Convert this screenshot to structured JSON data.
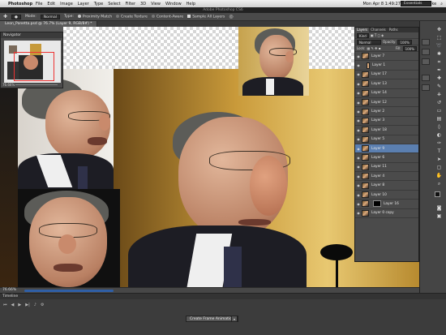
{
  "menubar": {
    "apple": "",
    "app": "Photoshop",
    "items": [
      "File",
      "Edit",
      "Image",
      "Layer",
      "Type",
      "Select",
      "Filter",
      "3D",
      "View",
      "Window",
      "Help"
    ],
    "clock": "Mon Apr 8  1:49:27 PM",
    "user": "Rodney Pike"
  },
  "titlebar": {
    "title": "Adobe Photoshop CS6"
  },
  "options": {
    "mode_label": "Mode:",
    "mode_value": "Normal",
    "type_label": "Type:",
    "proximity": "Proximity Match",
    "create_texture": "Create Texture",
    "content_aware": "Content-Aware",
    "sample_all": "Sample All Layers",
    "workspace": "Essentials"
  },
  "doc": {
    "tab": "Leon_Panetta.psd @ 76.7% (Layer 9, RGB/8#) *"
  },
  "navigator": {
    "title": "Navigator",
    "zoom": "76.66%"
  },
  "status": {
    "zoom": "76.66%"
  },
  "timeline": {
    "title": "Timeline",
    "create_frame_button": "Create Frame Animation"
  },
  "layers": {
    "tabs": [
      "Layers",
      "Channels",
      "Paths"
    ],
    "kind": "Kind",
    "blend": "Normal",
    "opacity_label": "Opacity:",
    "opacity": "100%",
    "lock_label": "Lock:",
    "fill_label": "Fill:",
    "fill": "100%",
    "items": [
      {
        "name": "Layer 7",
        "state": ""
      },
      {
        "name": "Layer 1",
        "state": ""
      },
      {
        "name": "Layer 17",
        "state": ""
      },
      {
        "name": "Layer 13",
        "state": ""
      },
      {
        "name": "Layer 14",
        "state": ""
      },
      {
        "name": "Layer 12",
        "state": ""
      },
      {
        "name": "Layer 2",
        "state": ""
      },
      {
        "name": "Layer 3",
        "state": ""
      },
      {
        "name": "Layer 18",
        "state": ""
      },
      {
        "name": "Layer 5",
        "state": ""
      },
      {
        "name": "Layer 9",
        "state": "selected"
      },
      {
        "name": "Layer 6",
        "state": ""
      },
      {
        "name": "Layer 11",
        "state": ""
      },
      {
        "name": "Layer 4",
        "state": ""
      },
      {
        "name": "Layer 8",
        "state": ""
      },
      {
        "name": "Layer 10",
        "state": ""
      },
      {
        "name": "Layer 16",
        "state": "mask"
      },
      {
        "name": "Layer 0 copy",
        "state": ""
      }
    ]
  },
  "colors": {
    "accent": "#5b7fb0",
    "panel": "#4b4b4b",
    "gold": "#c99a3a"
  }
}
